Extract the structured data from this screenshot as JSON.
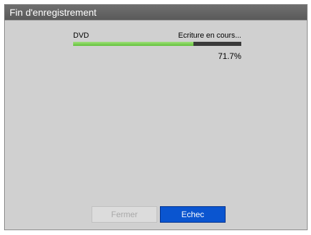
{
  "dialog": {
    "title": "Fin d'enregistrement"
  },
  "progress": {
    "media": "DVD",
    "status": "Ecriture en cours...",
    "percent_text": "71.7%",
    "value": 0.717,
    "colors": {
      "fill": "#62c23a",
      "track": "#3a3a3a"
    }
  },
  "buttons": {
    "close_label": "Fermer",
    "fail_label": "Echec"
  },
  "colors": {
    "accent": "#0a55d0",
    "title_bar": "#5f5f5f",
    "panel": "#d0d0d0"
  }
}
